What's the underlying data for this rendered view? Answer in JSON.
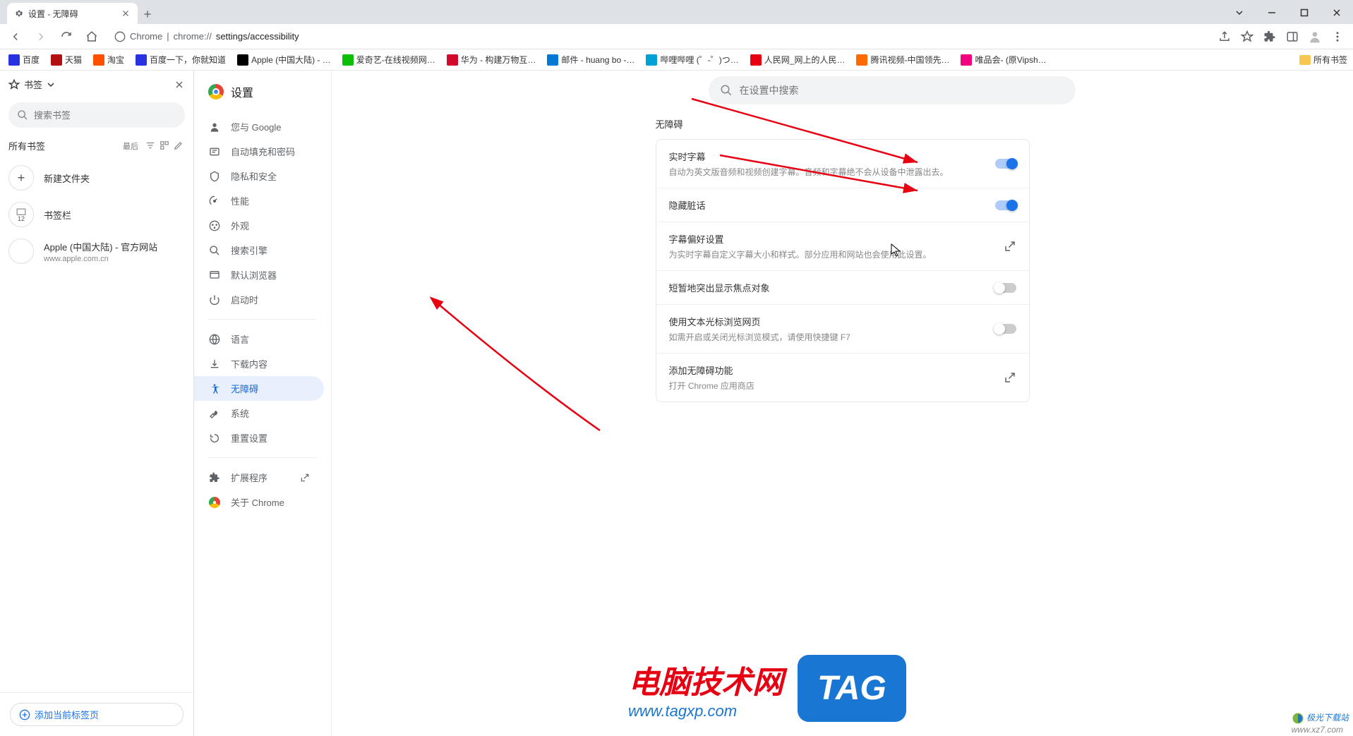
{
  "window": {
    "tab_title": "设置 - 无障碍"
  },
  "addressbar": {
    "scheme_label": "Chrome",
    "url_prefix": "chrome://",
    "url_path": "settings/accessibility"
  },
  "bookmarks_bar": {
    "items": [
      {
        "label": "百度",
        "color": "#2932e1"
      },
      {
        "label": "天猫",
        "color": "#b30e11"
      },
      {
        "label": "淘宝",
        "color": "#ff5000"
      },
      {
        "label": "百度一下，你就知道",
        "color": "#2932e1"
      },
      {
        "label": "Apple (中国大陆) - …",
        "color": "#000"
      },
      {
        "label": "爱奇艺-在线视频网…",
        "color": "#0bbe06"
      },
      {
        "label": "华为 - 构建万物互…",
        "color": "#cf0a2c"
      },
      {
        "label": "邮件 - huang bo -…",
        "color": "#0078d4"
      },
      {
        "label": "哔哩哔哩 (゜-゜)つ…",
        "color": "#00a1d6"
      },
      {
        "label": "人民网_网上的人民…",
        "color": "#e60012"
      },
      {
        "label": "腾讯视频-中国领先…",
        "color": "#ff6a00"
      },
      {
        "label": "唯品会- (原Vipsh…",
        "color": "#f10180"
      }
    ],
    "all_bookmarks": "所有书签"
  },
  "left_panel": {
    "bookmarks_label": "书签",
    "search_placeholder": "搜索书签",
    "all_bookmarks": "所有书签",
    "sort_label": "最后",
    "items": [
      {
        "icon": "+",
        "title": "新建文件夹",
        "sub": ""
      },
      {
        "icon_count": "12",
        "title": "书签栏",
        "sub": ""
      },
      {
        "icon": "",
        "title": "Apple (中国大陆) - 官方网站",
        "sub": "www.apple.com.cn"
      }
    ],
    "add_current": "添加当前标签页"
  },
  "settings": {
    "title": "设置",
    "search_placeholder": "在设置中搜索",
    "nav": [
      {
        "icon": "person",
        "label": "您与 Google"
      },
      {
        "icon": "autofill",
        "label": "自动填充和密码"
      },
      {
        "icon": "shield",
        "label": "隐私和安全"
      },
      {
        "icon": "speed",
        "label": "性能"
      },
      {
        "icon": "palette",
        "label": "外观"
      },
      {
        "icon": "search",
        "label": "搜索引擎"
      },
      {
        "icon": "browser",
        "label": "默认浏览器"
      },
      {
        "icon": "power",
        "label": "启动时"
      }
    ],
    "nav2": [
      {
        "icon": "globe",
        "label": "语言"
      },
      {
        "icon": "download",
        "label": "下载内容"
      },
      {
        "icon": "accessibility",
        "label": "无障碍",
        "active": true
      },
      {
        "icon": "wrench",
        "label": "系统"
      },
      {
        "icon": "reset",
        "label": "重置设置"
      }
    ],
    "nav3": [
      {
        "icon": "extension",
        "label": "扩展程序",
        "ext": true
      },
      {
        "icon": "chrome",
        "label": "关于 Chrome"
      }
    ],
    "section_title": "无障碍",
    "rows": [
      {
        "title": "实时字幕",
        "desc": "自动为英文版音频和视频创建字幕。音频和字幕绝不会从设备中泄露出去。",
        "toggle": true,
        "state": "on"
      },
      {
        "title": "隐藏脏话",
        "desc": "",
        "toggle": true,
        "state": "on"
      },
      {
        "title": "字幕偏好设置",
        "desc": "为实时字幕自定义字幕大小和样式。部分应用和网站也会使用此设置。",
        "ext": true
      },
      {
        "title": "短暂地突出显示焦点对象",
        "desc": "",
        "toggle": true,
        "state": "off"
      },
      {
        "title": "使用文本光标浏览网页",
        "desc": "如需开启或关闭光标浏览模式，请使用快捷键 F7",
        "toggle": true,
        "state": "off"
      },
      {
        "title": "添加无障碍功能",
        "desc": "打开 Chrome 应用商店",
        "ext": true
      }
    ]
  },
  "watermark": {
    "line1": "电脑技术网",
    "line2": "www.tagxp.com",
    "tag": "TAG"
  },
  "corner_wm": {
    "line1": "极光下载站",
    "line2": "www.xz7.com"
  }
}
